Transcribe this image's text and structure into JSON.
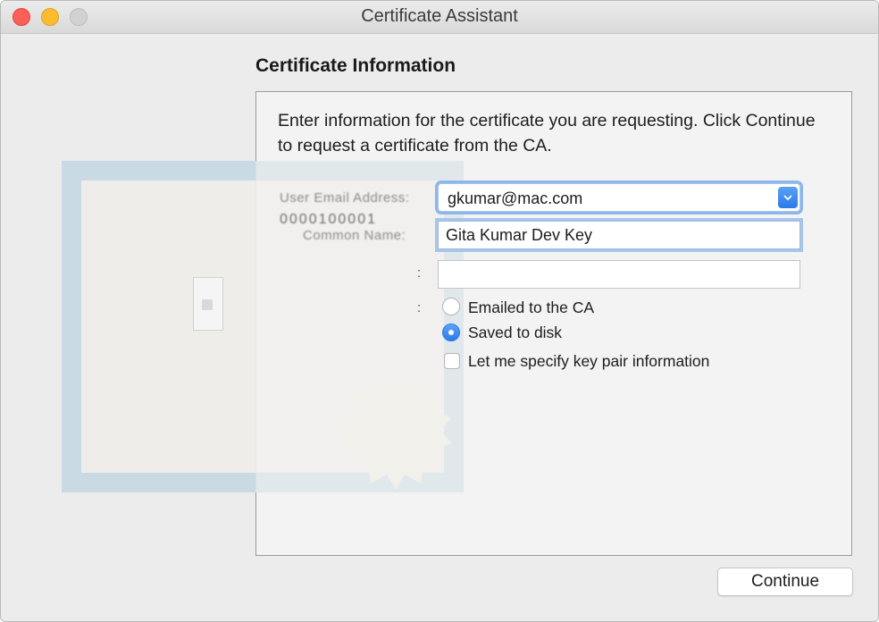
{
  "window": {
    "title": "Certificate Assistant"
  },
  "section": {
    "title": "Certificate Information"
  },
  "intro": "Enter information for the certificate you are requesting. Click Continue to request a certificate from the CA.",
  "form": {
    "email_label": "User Email Address:",
    "email_value": "gkumar@mac.com",
    "name_label": "Common Name:",
    "name_value": "Gita Kumar Dev Key",
    "ca_email_label": ":",
    "ca_email_value": "",
    "request_label": ":",
    "options": {
      "emailed": "Emailed to the CA",
      "saved": "Saved to disk",
      "specify": "Let me specify key pair information"
    },
    "selected_option": "saved",
    "specify_checked": false
  },
  "cert_art": {
    "line": "0000100001"
  },
  "buttons": {
    "continue": "Continue"
  },
  "colors": {
    "accent": "#2c7be8",
    "close": "#fc5f57",
    "minimize": "#fdbc2e"
  }
}
